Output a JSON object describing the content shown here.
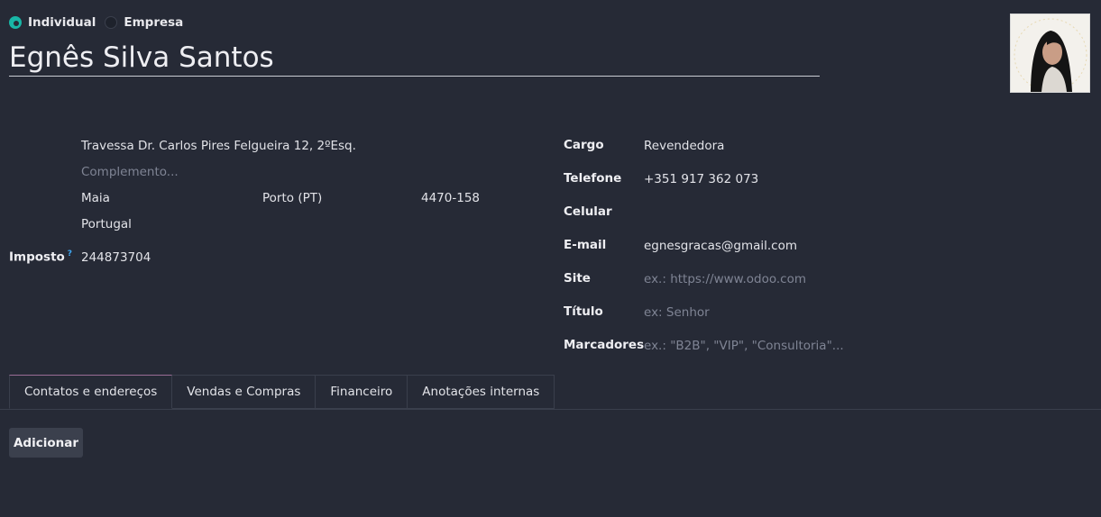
{
  "company_type": {
    "options": [
      {
        "label": "Individual",
        "selected": true
      },
      {
        "label": "Empresa",
        "selected": false
      }
    ]
  },
  "contact": {
    "name": "Egnês Silva Santos",
    "avatar_icon": "person-photo"
  },
  "address": {
    "street": "Travessa Dr. Carlos Pires Felgueira 12, 2ºEsq.",
    "street2_placeholder": "Complemento...",
    "city": "Maia",
    "state": "Porto (PT)",
    "zip": "4470-158",
    "country": "Portugal"
  },
  "tax": {
    "label": "Imposto",
    "help": "?",
    "value": "244873704"
  },
  "details": {
    "job_label": "Cargo",
    "job_value": "Revendedora",
    "phone_label": "Telefone",
    "phone_value": "+351 917 362 073",
    "mobile_label": "Celular",
    "mobile_value": "",
    "email_label": "E-mail",
    "email_value": "egnesgracas@gmail.com",
    "site_label": "Site",
    "site_placeholder": "ex.: https://www.odoo.com",
    "title_label": "Título",
    "title_placeholder": "ex: Senhor",
    "tags_label": "Marcadores",
    "tags_placeholder": "ex.: \"B2B\", \"VIP\", \"Consultoria\"..."
  },
  "tabs": [
    {
      "label": "Contatos e endereços",
      "active": true
    },
    {
      "label": "Vendas e Compras",
      "active": false
    },
    {
      "label": "Financeiro",
      "active": false
    },
    {
      "label": "Anotações internas",
      "active": false
    }
  ],
  "actions": {
    "add_label": "Adicionar"
  },
  "colors": {
    "background": "#262a36",
    "accent": "#19b6a6"
  }
}
